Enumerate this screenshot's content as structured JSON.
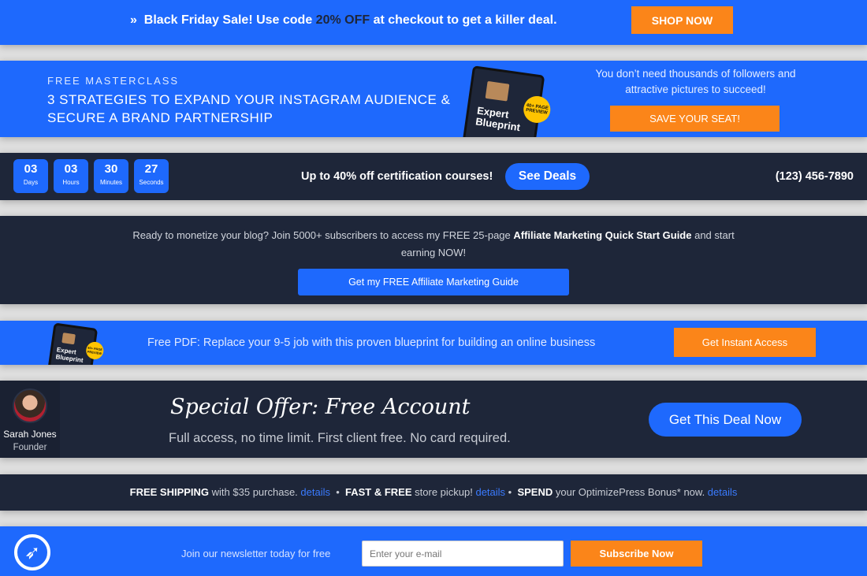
{
  "black_friday": {
    "icon": "double-chevron-right-icon",
    "text_before": "Black Friday Sale! Use code ",
    "code": "20% OFF",
    "text_after": " at checkout to get a killer deal.",
    "button": "SHOP NOW"
  },
  "masterclass": {
    "kicker": "FREE MASTERCLASS",
    "headline": "3 STRATEGIES TO EXPAND YOUR INSTAGRAM AUDIENCE & SECURE A BRAND PARTNERSHIP",
    "book_title": "Expert Blueprint",
    "book_badge": "40+ PAGE PREVIEW",
    "side_text": "You don’t need thousands of followers and attractive pictures to succeed!",
    "button": "SAVE YOUR SEAT!"
  },
  "countdown": {
    "units": [
      {
        "value": "03",
        "label": "Days"
      },
      {
        "value": "03",
        "label": "Hours"
      },
      {
        "value": "30",
        "label": "Minutes"
      },
      {
        "value": "27",
        "label": "Seconds"
      }
    ],
    "message": "Up to 40% off certification courses!",
    "button": "See Deals",
    "phone": "(123) 456-7890"
  },
  "affiliate": {
    "text_before": "Ready to monetize your blog? Join 5000+ subscribers to access my FREE 25-page ",
    "bold": "Affiliate Marketing Quick Start Guide",
    "text_after": " and start earning NOW!",
    "button": "Get my FREE Affiliate Marketing Guide"
  },
  "free_pdf": {
    "book_title": "Expert Blueprint",
    "book_badge": "40+ PAGE PREVIEW",
    "text": "Free PDF: Replace your 9-5 job with this proven blueprint for building an online business",
    "button": "Get Instant Access"
  },
  "special_offer": {
    "name": "Sarah Jones",
    "role": "Founder",
    "title": "Special Offer: Free Account",
    "subtitle": "Full access, no time limit. First client free. No card required.",
    "button": "Get This Deal Now"
  },
  "shipping": {
    "items": [
      {
        "bold": "FREE SHIPPING",
        "text": " with $35 purchase. ",
        "link": "details"
      },
      {
        "bold": "FAST & FREE",
        "text": " store pickup! ",
        "link": "details"
      },
      {
        "bold": "SPEND",
        "text": " your OptimizePress Bonus* now. ",
        "link": "details"
      }
    ],
    "separator": "•"
  },
  "newsletter": {
    "logo_icon": "rocket-icon",
    "text": "Join our newsletter today for free",
    "placeholder": "Enter your e-mail",
    "button": "Subscribe Now"
  },
  "colors": {
    "blue": "#1e69fd",
    "dark": "#1e2639",
    "orange": "#fb8519",
    "link": "#3a7bff"
  }
}
